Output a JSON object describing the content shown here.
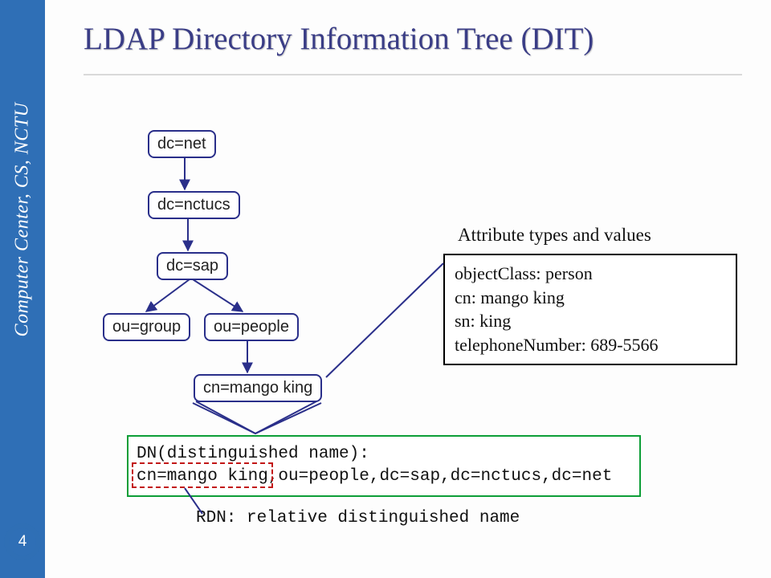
{
  "sidebar": {
    "label": "Computer Center, CS, NCTU",
    "page_number": "4"
  },
  "title": "LDAP Directory Information Tree (DIT)",
  "nodes": {
    "n1": "dc=net",
    "n2": "dc=nctucs",
    "n3": "dc=sap",
    "n4": "ou=group",
    "n5": "ou=people",
    "n6": "cn=mango king"
  },
  "attr": {
    "header": "Attribute types and values",
    "lines": {
      "l1": "objectClass: person",
      "l2": "cn: mango king",
      "l3": "sn: king",
      "l4": "telephoneNumber: 689-5566"
    }
  },
  "dn": {
    "label": "DN(distinguished name):",
    "value_rdn": "cn=mango king",
    "value_rest": ",ou=people,dc=sap,dc=nctucs,dc=net"
  },
  "rdn_label": "RDN: relative distinguished name"
}
